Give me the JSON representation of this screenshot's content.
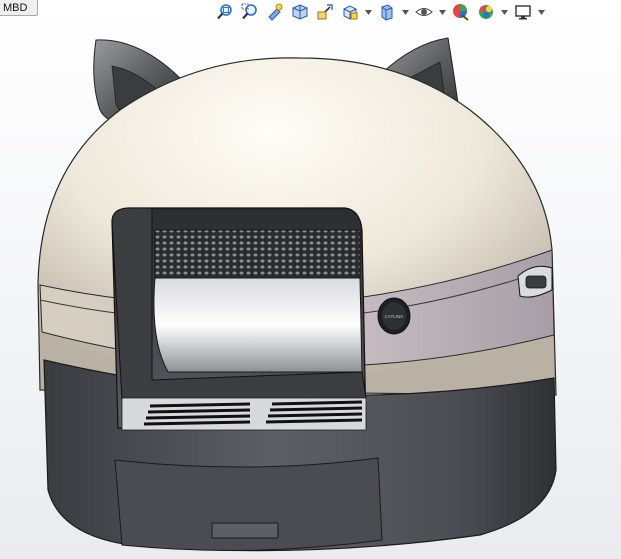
{
  "tab": {
    "label": "MBD"
  },
  "toolbar": {
    "items": [
      {
        "name": "zoom-to-fit-icon",
        "kind": "button"
      },
      {
        "name": "zoom-to-area-icon",
        "kind": "button"
      },
      {
        "name": "previous-view-icon",
        "kind": "button"
      },
      {
        "name": "section-view-icon",
        "kind": "button"
      },
      {
        "name": "dynamic-annotation-icon",
        "kind": "button"
      },
      {
        "name": "view-orientation-icon",
        "kind": "button",
        "dropdown": true
      },
      {
        "name": "display-style-icon",
        "kind": "button",
        "dropdown": true
      },
      {
        "name": "hide-show-items-icon",
        "kind": "button",
        "dropdown": true
      },
      {
        "name": "edit-appearance-icon",
        "kind": "button"
      },
      {
        "name": "apply-scene-icon",
        "kind": "button",
        "dropdown": true
      },
      {
        "name": "view-settings-icon",
        "kind": "button",
        "dropdown": true
      }
    ]
  },
  "model": {
    "badge_text": "CATLINK"
  },
  "colors": {
    "shell": "#e9e3d6",
    "base": "#4a4d52",
    "ears": "#6c6d70",
    "accent_blue": "#2a6fd6"
  }
}
